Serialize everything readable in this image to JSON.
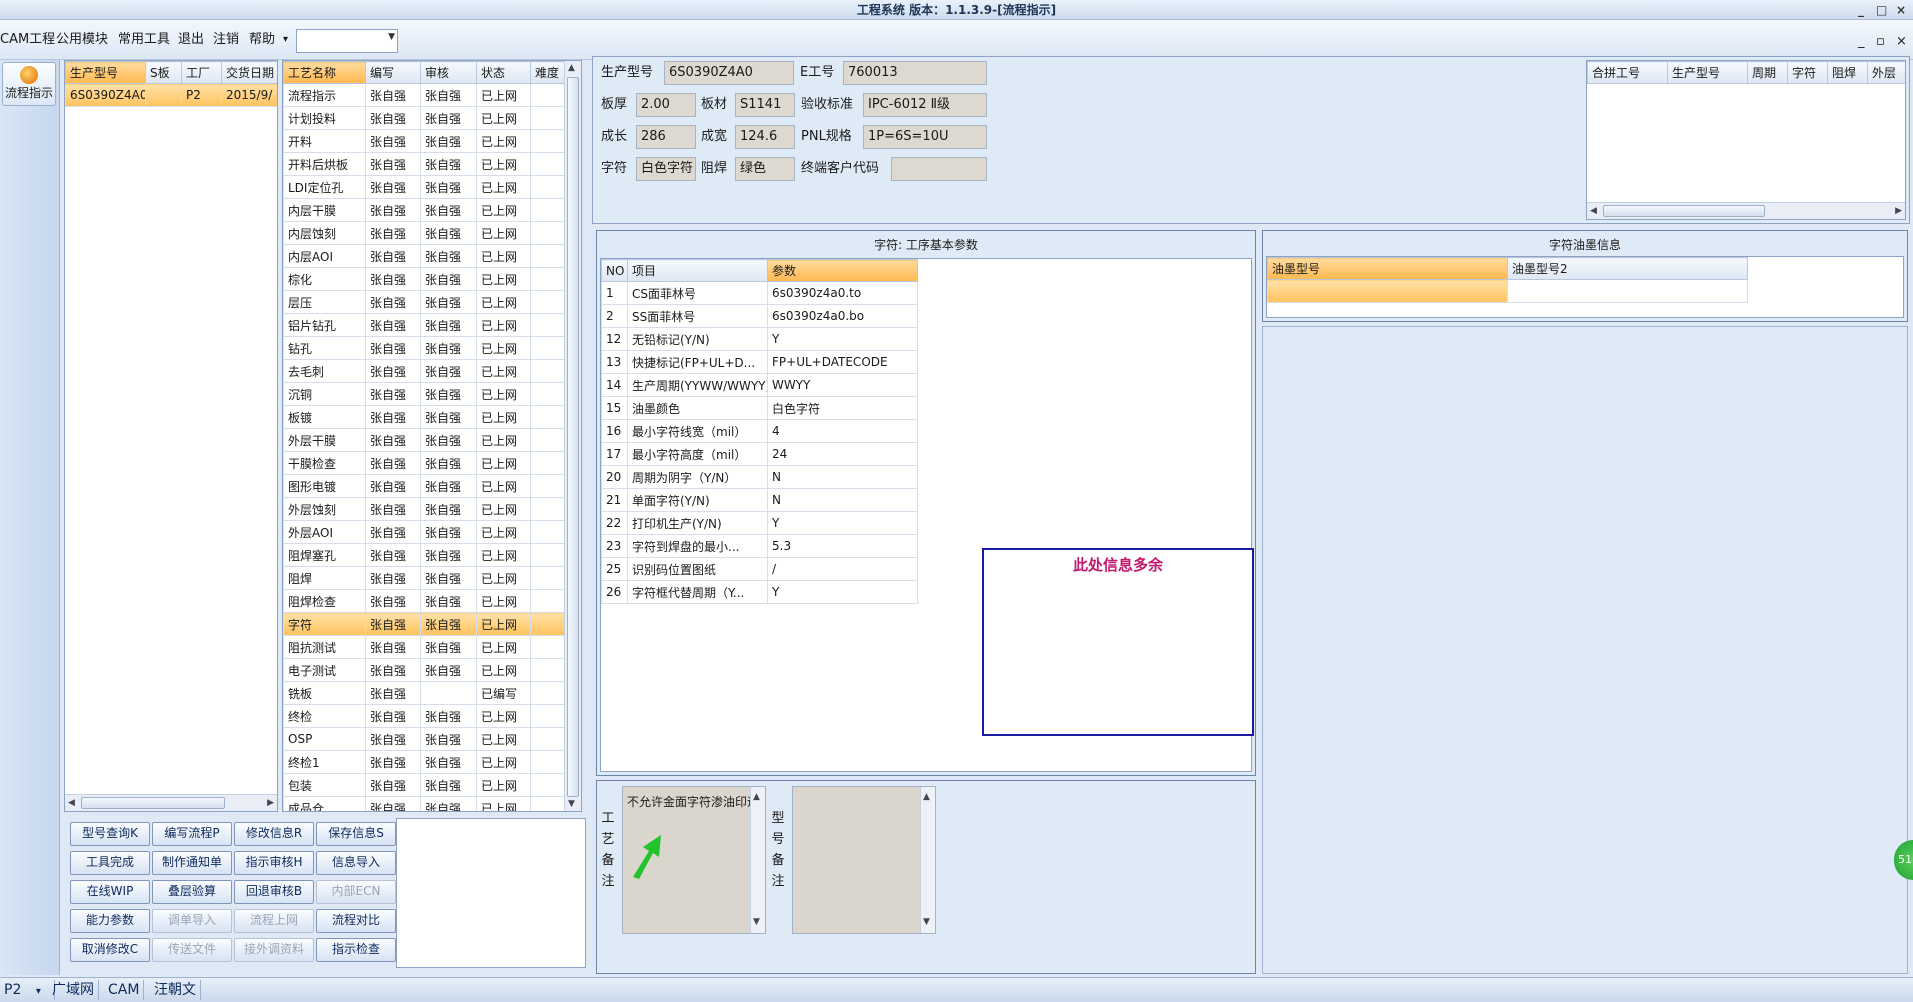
{
  "window": {
    "title": "工程系统 版本：1.1.3.9-[流程指示]",
    "controls": [
      "_",
      "□",
      "×"
    ]
  },
  "menu": {
    "items": [
      "CAM工程",
      "公用模块",
      "常用工具",
      "退出",
      "注销",
      "帮助"
    ],
    "help_arrow": "▾",
    "combo_value": "",
    "mdi_controls": [
      "_",
      "▫",
      "×"
    ]
  },
  "left_strip": {
    "flow_button": "流程指示"
  },
  "model_table": {
    "columns": [
      "生产型号",
      "S板",
      "工厂",
      "交货日期"
    ],
    "rows": [
      [
        "6S0390Z4A0",
        "",
        "P2",
        "2015/9/"
      ]
    ]
  },
  "process_table": {
    "columns": [
      "工艺名称",
      "编写",
      "审核",
      "状态",
      "难度"
    ],
    "selected_index": 23,
    "rows": [
      [
        "流程指示",
        "张自强",
        "张自强",
        "已上网",
        ""
      ],
      [
        "计划投料",
        "张自强",
        "张自强",
        "已上网",
        ""
      ],
      [
        "开料",
        "张自强",
        "张自强",
        "已上网",
        ""
      ],
      [
        "开料后烘板",
        "张自强",
        "张自强",
        "已上网",
        ""
      ],
      [
        "LDI定位孔",
        "张自强",
        "张自强",
        "已上网",
        ""
      ],
      [
        "内层干膜",
        "张自强",
        "张自强",
        "已上网",
        ""
      ],
      [
        "内层蚀刻",
        "张自强",
        "张自强",
        "已上网",
        ""
      ],
      [
        "内层AOI",
        "张自强",
        "张自强",
        "已上网",
        ""
      ],
      [
        "棕化",
        "张自强",
        "张自强",
        "已上网",
        ""
      ],
      [
        "层压",
        "张自强",
        "张自强",
        "已上网",
        ""
      ],
      [
        "铝片钻孔",
        "张自强",
        "张自强",
        "已上网",
        ""
      ],
      [
        "钻孔",
        "张自强",
        "张自强",
        "已上网",
        ""
      ],
      [
        "去毛刺",
        "张自强",
        "张自强",
        "已上网",
        ""
      ],
      [
        "沉铜",
        "张自强",
        "张自强",
        "已上网",
        ""
      ],
      [
        "板镀",
        "张自强",
        "张自强",
        "已上网",
        ""
      ],
      [
        "外层干膜",
        "张自强",
        "张自强",
        "已上网",
        ""
      ],
      [
        "干膜检查",
        "张自强",
        "张自强",
        "已上网",
        ""
      ],
      [
        "图形电镀",
        "张自强",
        "张自强",
        "已上网",
        ""
      ],
      [
        "外层蚀刻",
        "张自强",
        "张自强",
        "已上网",
        ""
      ],
      [
        "外层AOI",
        "张自强",
        "张自强",
        "已上网",
        ""
      ],
      [
        "阻焊塞孔",
        "张自强",
        "张自强",
        "已上网",
        ""
      ],
      [
        "阻焊",
        "张自强",
        "张自强",
        "已上网",
        ""
      ],
      [
        "阻焊检查",
        "张自强",
        "张自强",
        "已上网",
        ""
      ],
      [
        "字符",
        "张自强",
        "张自强",
        "已上网",
        ""
      ],
      [
        "阻抗测试",
        "张自强",
        "张自强",
        "已上网",
        ""
      ],
      [
        "电子测试",
        "张自强",
        "张自强",
        "已上网",
        ""
      ],
      [
        "铣板",
        "张自强",
        "",
        "已编写",
        ""
      ],
      [
        "终检",
        "张自强",
        "张自强",
        "已上网",
        ""
      ],
      [
        "OSP",
        "张自强",
        "张自强",
        "已上网",
        ""
      ],
      [
        "终检1",
        "张自强",
        "张自强",
        "已上网",
        ""
      ],
      [
        "包装",
        "张自强",
        "张自强",
        "已上网",
        ""
      ],
      [
        "成品仓",
        "张自强",
        "张自强",
        "已上网",
        ""
      ]
    ]
  },
  "buttons": [
    {
      "label": "型号查询K",
      "enabled": true
    },
    {
      "label": "编写流程P",
      "enabled": true
    },
    {
      "label": "修改信息R",
      "enabled": true
    },
    {
      "label": "保存信息S",
      "enabled": true
    },
    {
      "label": "工具完成",
      "enabled": true
    },
    {
      "label": "制作通知单",
      "enabled": true
    },
    {
      "label": "指示审核H",
      "enabled": true
    },
    {
      "label": "信息导入",
      "enabled": true
    },
    {
      "label": "在线WIP",
      "enabled": true
    },
    {
      "label": "叠层验算",
      "enabled": true
    },
    {
      "label": "回退审核B",
      "enabled": true
    },
    {
      "label": "内部ECN",
      "enabled": false
    },
    {
      "label": "能力参数",
      "enabled": true
    },
    {
      "label": "调单导入",
      "enabled": false
    },
    {
      "label": "流程上网",
      "enabled": false
    },
    {
      "label": "流程对比",
      "enabled": true
    },
    {
      "label": "取消修改C",
      "enabled": true
    },
    {
      "label": "传送文件",
      "enabled": false
    },
    {
      "label": "接外调资料",
      "enabled": false
    },
    {
      "label": "指示检查",
      "enabled": true
    }
  ],
  "info_form": {
    "model_label": "生产型号",
    "model_value": "6S0390Z4A0",
    "e_label": "E工号",
    "e_value": "760013",
    "thick_label": "板厚",
    "thick_value": "2.00",
    "mat_label": "板材",
    "mat_value": "S1141",
    "std_label": "验收标准",
    "std_value": "IPC-6012 Ⅱ级",
    "len_label": "成长",
    "len_value": "286",
    "wid_label": "成宽",
    "wid_value": "124.6",
    "pnl_label": "PNL规格",
    "pnl_value": "1P=6S=10U",
    "char_label": "字符",
    "char_value": "白色字符",
    "mask_label": "阻焊",
    "mask_value": "绿色",
    "cust_label": "终端客户代码",
    "cust_value": ""
  },
  "combine_table": {
    "columns": [
      "合拼工号",
      "生产型号",
      "周期",
      "字符",
      "阻焊",
      "外层"
    ]
  },
  "param_section": {
    "title": "字符: 工序基本参数",
    "columns": [
      "NO",
      "项目",
      "参数"
    ],
    "selected_index": 15,
    "rows": [
      [
        "1",
        "CS面菲林号",
        "6s0390z4a0.to"
      ],
      [
        "2",
        "SS面菲林号",
        "6s0390z4a0.bo"
      ],
      [
        "12",
        "无铅标记(Y/N)",
        "Y"
      ],
      [
        "13",
        "快捷标记(FP+UL+D...",
        "FP+UL+DATECODE"
      ],
      [
        "14",
        "生产周期(YYWW/WWYY)",
        "WWYY"
      ],
      [
        "15",
        "油墨颜色",
        "白色字符"
      ],
      [
        "16",
        "最小字符线宽（mil）",
        "4"
      ],
      [
        "17",
        "最小字符高度（mil）",
        "24"
      ],
      [
        "20",
        "周期为阴字（Y/N）",
        "N"
      ],
      [
        "21",
        "单面字符(Y/N)",
        "N"
      ],
      [
        "22",
        "打印机生产(Y/N)",
        "Y"
      ],
      [
        "23",
        "字符到焊盘的最小...",
        "5.3"
      ],
      [
        "25",
        "识别码位置图纸",
        "/"
      ],
      [
        "26",
        "字符框代替周期（Y...",
        "Y"
      ]
    ],
    "annotation": "此处信息多余"
  },
  "ink_section": {
    "title": "字符油墨信息",
    "columns": [
      "油墨型号",
      "油墨型号2"
    ]
  },
  "remarks": {
    "process_label": "工艺备注",
    "process_text": "不允许金面字符渗油印迹",
    "model_label": "型号备注",
    "model_text": ""
  },
  "float_badge": "51",
  "status_bar": {
    "cells": [
      "P2",
      "广域网",
      "CAM",
      "汪朝文"
    ],
    "arrow": "▾"
  },
  "colors": {
    "accent_selected": "#ffc35e",
    "annotation_border": "#1a1aa8",
    "annotation_text": "#c21a6e",
    "arrow_green": "#22c32b"
  }
}
